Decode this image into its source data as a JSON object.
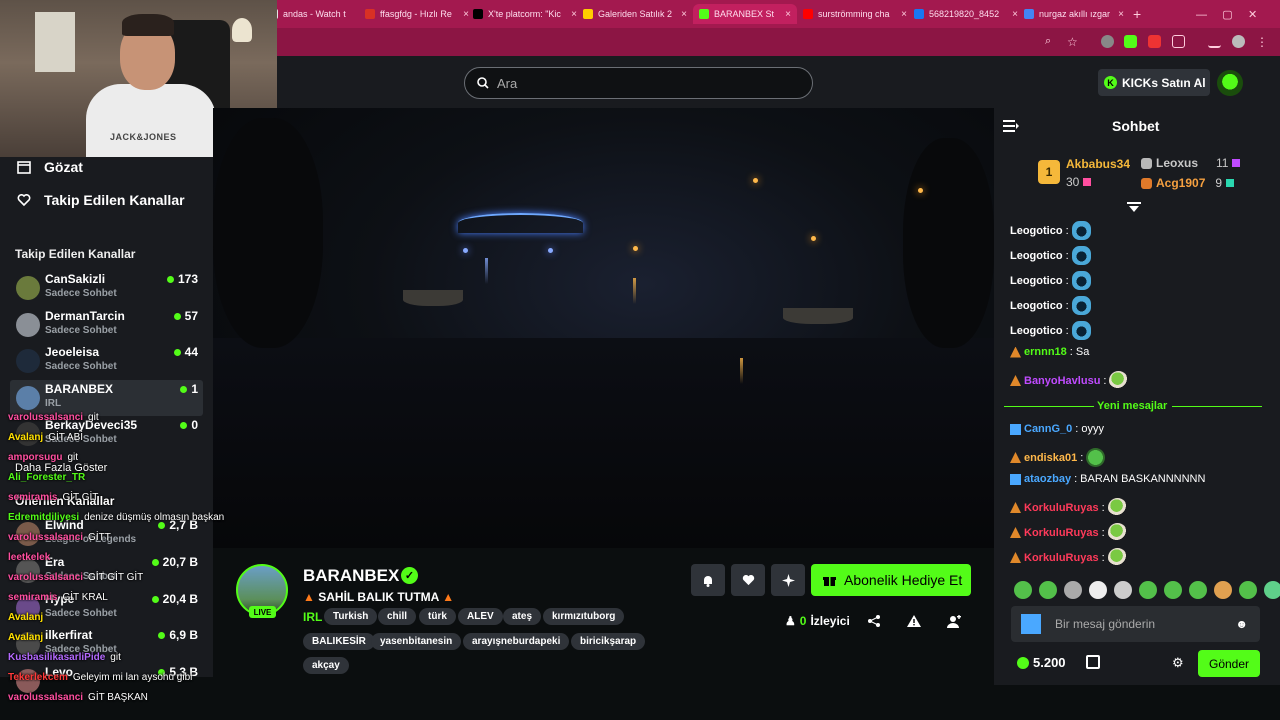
{
  "browser": {
    "tabs": [
      {
        "label": "andas - Watch t",
        "color": "#e5e5e5"
      },
      {
        "label": "ffasgfdg - Hızlı Re",
        "color": "#d93025"
      },
      {
        "label": "X'te platcorm: \"Kic",
        "color": "#000000"
      },
      {
        "label": "Galeriden Satılık 2",
        "color": "#ffcd00"
      },
      {
        "label": "BARANBEX St",
        "color": "#53fc18"
      },
      {
        "label": "surströmming cha",
        "color": "#ff0000"
      },
      {
        "label": "568219820_8452",
        "color": "#1877f2"
      },
      {
        "label": "nurgaz akıllı ızgar",
        "color": "#4285f4"
      }
    ]
  },
  "header": {
    "search_placeholder": "Ara",
    "kicks_button": "KICKs Satın Al"
  },
  "webcam": {
    "shirt_text": "JACK&JONES"
  },
  "sidebar": {
    "nav": [
      {
        "label": "Gözat"
      },
      {
        "label": "Takip Edilen Kanallar"
      }
    ],
    "followed_heading": "Takip Edilen Kanallar",
    "channels": [
      {
        "name": "CanSakizli",
        "sub": "Sadece Sohbet",
        "count": "173",
        "color": "#6a7a3c"
      },
      {
        "name": "DermanTarcin",
        "sub": "Sadece Sohbet",
        "count": "57",
        "color": "#8a8f96"
      },
      {
        "name": "Jeoeleisa",
        "sub": "Sadece Sohbet",
        "count": "44",
        "color": "#1e2a3a"
      },
      {
        "name": "BARANBEX",
        "sub": "IRL",
        "count": "1",
        "color": "#5b7fa8"
      },
      {
        "name": "BerkayDeveci35",
        "sub": "Sadece Sohbet",
        "count": "0",
        "color": "#333"
      }
    ],
    "show_more": "Daha Fazla Göster",
    "recommended_heading": "Önerilen Kanallar",
    "recommended": [
      {
        "name": "Elwind",
        "sub": "League of Legends",
        "count": "2,7 B",
        "color": "#7a5a4a"
      },
      {
        "name": "Era",
        "sub": "Sadece Sohbet",
        "count": "20,7 B",
        "color": "#555"
      },
      {
        "name": "Hype",
        "sub": "Sadece Sohbet",
        "count": "20,4 B",
        "color": "#6a4a8a"
      },
      {
        "name": "ilkerfirat",
        "sub": "Sadece Sohbet",
        "count": "6,9 B",
        "color": "#4a4a4a"
      },
      {
        "name": "Levo",
        "sub": "",
        "count": "5,3 B",
        "color": "#8a5a5a"
      }
    ]
  },
  "overlay_chat": [
    {
      "user": "varolussalsanci",
      "color": "#ff4fa0",
      "msg": "git"
    },
    {
      "user": "Avalanj",
      "color": "#ffe000",
      "msg": "GİT ABİ"
    },
    {
      "user": "amporsugu",
      "color": "#ff4fa0",
      "msg": "git"
    },
    {
      "user": "Ali_Forester_TR",
      "color": "#53fc18",
      "msg": ""
    },
    {
      "user": "semiramis",
      "color": "#ff4fa0",
      "msg": "GİT GİT"
    },
    {
      "user": "Edremitdiliyesi",
      "color": "#53fc18",
      "msg": "denize düşmüş olmasın başkan"
    },
    {
      "user": "varolussalsanci",
      "color": "#ff4fa0",
      "msg": "GİTT"
    },
    {
      "user": "leetkelek",
      "color": "#ff4fa0",
      "msg": ""
    },
    {
      "user": "varolussalsanci",
      "color": "#ff4fa0",
      "msg": "GİT GİT GİT"
    },
    {
      "user": "semiramis",
      "color": "#ff4fa0",
      "msg": "GİT KRAL"
    },
    {
      "user": "Avalanj",
      "color": "#ffe000",
      "msg": ""
    },
    {
      "user": "Avalanj",
      "color": "#ffe000",
      "msg": ""
    },
    {
      "user": "KusbasilikasarliPide",
      "color": "#b469ff",
      "msg": "git"
    },
    {
      "user": "Tekerlekcem",
      "color": "#ff3a3a",
      "msg": "Geleyim mi lan aysohu gibi"
    },
    {
      "user": "varolussalsanci",
      "color": "#ff4fa0",
      "msg": "GİT BAŞKAN"
    }
  ],
  "stream": {
    "streamer": "BARANBEX",
    "live_label": "LIVE",
    "title": "SAHİL BALIK TUTMA",
    "category": "IRL",
    "tags": [
      "Turkish",
      "chill",
      "türk",
      "ALEV",
      "ateş",
      "kırmızıtuborg",
      "BALIKESİR",
      "yasenbitanesin",
      "arayışneburdapeki",
      "biricikşarap",
      "akçay"
    ],
    "gift_button": "Abonelik Hediye Et",
    "viewer_count": "0",
    "viewer_label": "İzleyici"
  },
  "chat": {
    "title": "Sohbet",
    "leaderboard": [
      {
        "rank": "1",
        "name": "Akbabus34",
        "amount": "30",
        "color": "#f5b83a"
      },
      {
        "rank": "2",
        "name": "Leoxus",
        "amount": "11",
        "color": "#b8b8b8"
      },
      {
        "rank": "3",
        "name": "Acg1907",
        "amount": "9",
        "color": "#e07a2a"
      }
    ],
    "messages": [
      {
        "user": "Leogotico",
        "color": "#ffffff",
        "text": "",
        "emote": "alien"
      },
      {
        "user": "Leogotico",
        "color": "#ffffff",
        "text": "",
        "emote": "alien"
      },
      {
        "user": "Leogotico",
        "color": "#ffffff",
        "text": "",
        "emote": "alien"
      },
      {
        "user": "Leogotico",
        "color": "#ffffff",
        "text": "",
        "emote": "alien"
      },
      {
        "user": "Leogotico",
        "color": "#ffffff",
        "text": "",
        "emote": "alien"
      },
      {
        "user": "ernnn18",
        "color": "#53fc18",
        "text": "Sa",
        "emote": ""
      },
      {
        "user": "BanyoHavlusu",
        "color": "#c04bff",
        "text": "",
        "emote": "pepe"
      }
    ],
    "new_messages_label": "Yeni mesajlar",
    "new_messages": [
      {
        "user": "CannG_0",
        "color": "#4aa8ff",
        "text": "oyyy",
        "emote": ""
      },
      {
        "user": "endiska01",
        "color": "#ffb84a",
        "text": "",
        "emote": "frog"
      },
      {
        "user": "ataozbay",
        "color": "#4aa8ff",
        "text": "BARAN BASKANNNNNN",
        "emote": ""
      },
      {
        "user": "KorkuluRuyas",
        "color": "#ff3a5a",
        "text": "",
        "emote": "pepe"
      },
      {
        "user": "KorkuluRuyas",
        "color": "#ff3a5a",
        "text": "",
        "emote": "pepe"
      },
      {
        "user": "KorkuluRuyas",
        "color": "#ff3a5a",
        "text": "",
        "emote": "pepe"
      }
    ],
    "input_placeholder": "Bir mesaj gönderin",
    "kicks_balance": "5.200",
    "send_button": "Gönder"
  }
}
